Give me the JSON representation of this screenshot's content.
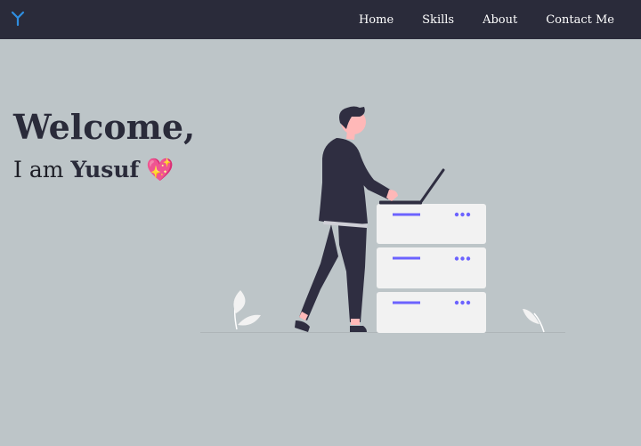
{
  "nav": {
    "logo_icon": "y-branch-logo-icon",
    "links": [
      "Home",
      "Skills",
      "About",
      "Contact Me"
    ]
  },
  "hero": {
    "greeting": "Welcome,",
    "intro_prefix": "I am ",
    "name": "Yusuf",
    "emoji": "💖"
  },
  "colors": {
    "background": "#bdc5c8",
    "navbar": "#2a2b3a",
    "accent": "#6c63ff",
    "logo": "#2f8ee0"
  }
}
